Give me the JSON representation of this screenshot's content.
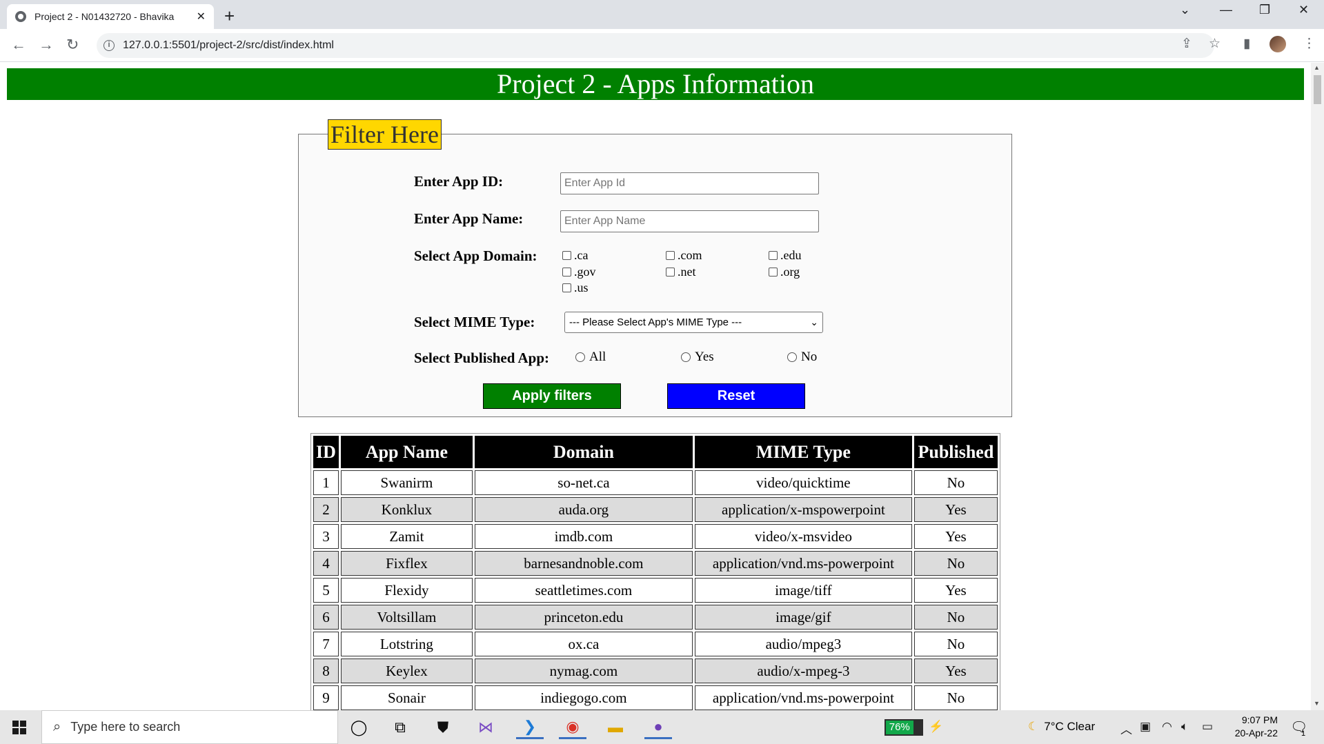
{
  "browser": {
    "tab_title": "Project 2 - N01432720 - Bhavika",
    "url": "127.0.0.1:5501/project-2/src/dist/index.html"
  },
  "page": {
    "title": "Project 2 - Apps Information",
    "filter_legend": "Filter Here",
    "labels": {
      "app_id": "Enter App ID:",
      "app_name": "Enter App Name:",
      "app_domain": "Select App Domain:",
      "mime_type": "Select MIME Type:",
      "published": "Select Published App:"
    },
    "placeholders": {
      "app_id": "Enter App Id",
      "app_name": "Enter App Name"
    },
    "domains": [
      ".ca",
      ".com",
      ".edu",
      ".gov",
      ".net",
      ".org",
      ".us"
    ],
    "mime_select": "--- Please Select App's MIME Type ---",
    "published_options": [
      "All",
      "Yes",
      "No"
    ],
    "buttons": {
      "apply": "Apply filters",
      "reset": "Reset"
    },
    "table": {
      "headers": [
        "ID",
        "App Name",
        "Domain",
        "MIME Type",
        "Published"
      ],
      "rows": [
        [
          "1",
          "Swanirm",
          "so-net.ca",
          "video/quicktime",
          "No"
        ],
        [
          "2",
          "Konklux",
          "auda.org",
          "application/x-mspowerpoint",
          "Yes"
        ],
        [
          "3",
          "Zamit",
          "imdb.com",
          "video/x-msvideo",
          "Yes"
        ],
        [
          "4",
          "Fixflex",
          "barnesandnoble.com",
          "application/vnd.ms-powerpoint",
          "No"
        ],
        [
          "5",
          "Flexidy",
          "seattletimes.com",
          "image/tiff",
          "Yes"
        ],
        [
          "6",
          "Voltsillam",
          "princeton.edu",
          "image/gif",
          "No"
        ],
        [
          "7",
          "Lotstring",
          "ox.ca",
          "audio/mpeg3",
          "No"
        ],
        [
          "8",
          "Keylex",
          "nymag.com",
          "audio/x-mpeg-3",
          "Yes"
        ],
        [
          "9",
          "Sonair",
          "indiegogo.com",
          "application/vnd.ms-powerpoint",
          "No"
        ]
      ]
    }
  },
  "taskbar": {
    "search_placeholder": "Type here to search",
    "battery": "76%",
    "weather": "7°C  Clear",
    "time": "9:07 PM",
    "date": "20-Apr-22",
    "notification_count": "1"
  },
  "colors": {
    "banner": "#008000",
    "legend": "#ffd700",
    "apply_button": "#008000",
    "reset_button": "#0000ff",
    "table_header": "#000000",
    "even_row": "#dcdcdc"
  }
}
